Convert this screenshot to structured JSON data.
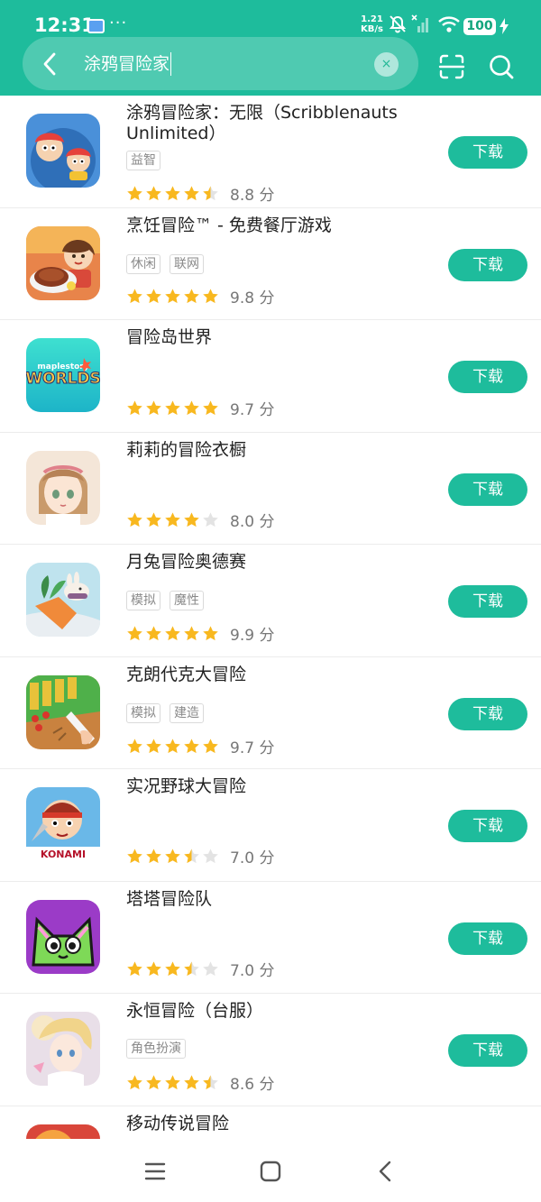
{
  "status_bar": {
    "time": "12:31",
    "dots": "···",
    "net_speed_value": "1.21",
    "net_speed_unit": "KB/s",
    "battery": "100"
  },
  "search": {
    "query": "涂鸦冒险家",
    "clear_glyph": "×"
  },
  "download_label": "下载",
  "apps": [
    {
      "name": "涂鸦冒险家：无限（Scribblenauts Unlimited）",
      "tags": [
        "益智"
      ],
      "stars": 4.5,
      "score": "8.8 分"
    },
    {
      "name": "烹饪冒险™ - 免费餐厅游戏",
      "tags": [
        "休闲",
        "联网"
      ],
      "stars": 5,
      "score": "9.8 分"
    },
    {
      "name": "冒险岛世界",
      "tags": [],
      "stars": 5,
      "score": "9.7 分"
    },
    {
      "name": "莉莉的冒险衣橱",
      "tags": [],
      "stars": 4,
      "score": "8.0 分"
    },
    {
      "name": "月兔冒险奥德赛",
      "tags": [
        "模拟",
        "魔性"
      ],
      "stars": 5,
      "score": "9.9 分"
    },
    {
      "name": "克朗代克大冒险",
      "tags": [
        "模拟",
        "建造"
      ],
      "stars": 5,
      "score": "9.7 分"
    },
    {
      "name": "实况野球大冒险",
      "tags": [],
      "stars": 3.5,
      "score": "7.0 分"
    },
    {
      "name": "塔塔冒险队",
      "tags": [],
      "stars": 3.5,
      "score": "7.0 分"
    },
    {
      "name": "永恒冒险（台服）",
      "tags": [
        "角色扮演"
      ],
      "stars": 4.5,
      "score": "8.6 分"
    },
    {
      "name": "移动传说冒险",
      "tags": [],
      "stars": 0,
      "score": ""
    }
  ],
  "icon_texts": {
    "maplestory_small": "maplestory",
    "maplestory_big": "WORLDS",
    "konami": "KONAMI"
  },
  "colors": {
    "accent": "#1ebc9c",
    "star": "#f8b81f",
    "star_empty": "#e3e3e3"
  }
}
